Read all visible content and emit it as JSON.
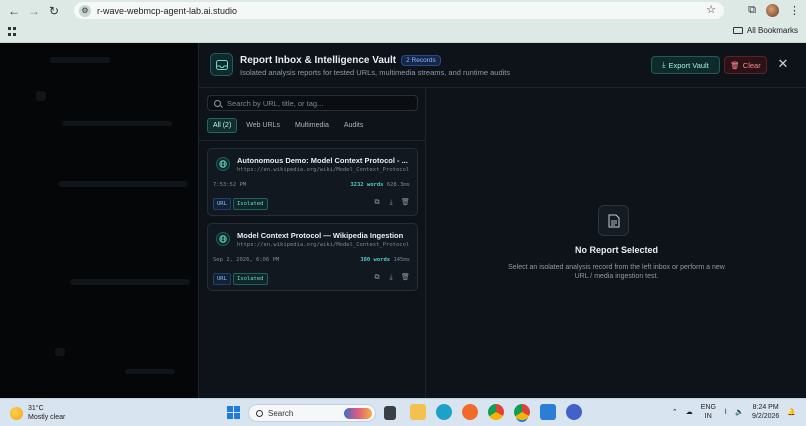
{
  "browser": {
    "url": "r-wave-webmcp-agent-lab.ai.studio",
    "all_bookmarks": "All Bookmarks"
  },
  "panel": {
    "title": "Report Inbox & Intelligence Vault",
    "records_badge": "2 Records",
    "subtitle": "Isolated analysis reports for tested URLs, multimedia streams, and runtime audits",
    "export_label": "Export Vault",
    "clear_label": "Clear",
    "close_glyph": "✕"
  },
  "inbox": {
    "search_placeholder": "Search by URL, title, or tag...",
    "filters": [
      "All (2)",
      "Web URLs",
      "Multimedia",
      "Audits"
    ],
    "cards": [
      {
        "title": "Autonomous Demo: Model Context Protocol - ...",
        "url": "https://en.wikipedia.org/wiki/Model_Context_Protocol",
        "time": "7:53:52 PM",
        "words": "3232 words",
        "duration": "628.3ms",
        "tags": [
          "URL",
          "Isolated"
        ]
      },
      {
        "title": "Model Context Protocol — Wikipedia Ingestion",
        "url": "https://en.wikipedia.org/wiki/Model_Context_Protocol",
        "time": "Sep 2, 2026, 6:06 PM",
        "words": "380 words",
        "duration": "145ms",
        "tags": [
          "URL",
          "Isolated"
        ]
      }
    ]
  },
  "empty_state": {
    "title": "No Report Selected",
    "description": "Select an isolated analysis record from the left inbox or perform a new URL / media ingestion test."
  },
  "taskbar": {
    "temperature": "31°C",
    "condition": "Mostly clear",
    "search_label": "Search",
    "lang_line1": "ENG",
    "lang_line2": "IN",
    "time": "8:24 PM",
    "date": "9/2/2026"
  },
  "colors": {
    "accent_teal": "#4fd1c5",
    "danger": "#ff8c95",
    "panel_bg": "#0e1319"
  }
}
